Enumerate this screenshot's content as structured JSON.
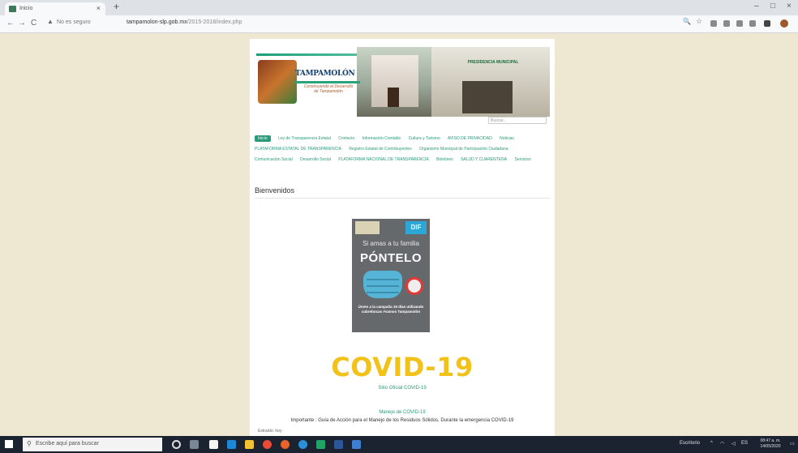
{
  "browser": {
    "tab_title": "Inicio",
    "tab_close": "×",
    "new_tab": "+",
    "minimize": "–",
    "maximize": "□",
    "close": "×",
    "back": "←",
    "forward": "→",
    "reload": "C",
    "insecure_label": "No es seguro",
    "url_host": "tampamolon-slp.gob.mx",
    "url_path": "/2015-2018/index.php"
  },
  "site": {
    "logo_title": "TAMPAMOLÓN",
    "logo_subtitle": "Construyendo el Desarrollo de Tampamolón",
    "building_sign": "PRESIDENCIA MUNICIPAL",
    "search_placeholder": "Buscar...",
    "menu": [
      "Inicio",
      "Ley de Transparencia Estatal",
      "Contacto",
      "Información Contable",
      "Cultura y Turismo",
      "AVISO DE PRIVACIDAD",
      "Noticias",
      "PLATAFORMA ESTATAL DE TRANSPARENCIA",
      "Registro Estatal de Contribuyentes",
      "Organismo Municipal de Participación Ciudadana",
      "Comunicación Social",
      "Desarrollo Social",
      "PLATAFORMA NACIONAL DE TRANSPARENCIA",
      "Boletines",
      "SALUD Y CUARENTENA",
      "Servicios"
    ],
    "welcome": "Bienvenidos",
    "poster_dif": "DIF",
    "poster_small": "Si amas a tu familia",
    "poster_big": "PÓNTELO",
    "poster_foot": "Únete a la campaña 19 días utilizando cubrebocas #vamos Tampamolón",
    "covid_title": "COVID-19",
    "site_link": "Sitio Oficial COVID-19",
    "ms_link": "Manejo de COVID-19",
    "important": "Importante : Guía de Acción para el Manejo de los Residuos Sólidos, Durante la emergencia COVID-19",
    "extract": "Extraído: hoy"
  },
  "taskbar": {
    "search_placeholder": "Escribe aquí para buscar",
    "tray_label": "Escritorio",
    "language": "ES",
    "time": "08:47 a. m.",
    "date": "14/05/2020"
  },
  "icons": [
    "search-icon",
    "windows-start-icon",
    "task-view-icon",
    "edge-icon",
    "file-explorer-icon",
    "store-icon",
    "mail-icon",
    "chrome-icon",
    "firefox-icon",
    "notification-icon"
  ]
}
